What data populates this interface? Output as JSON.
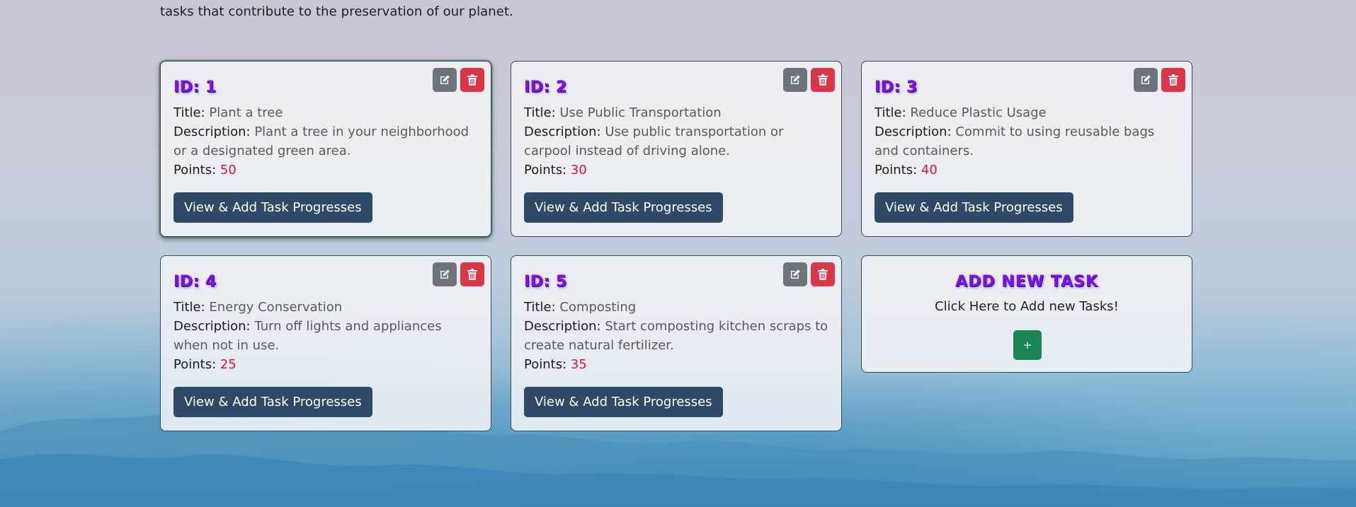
{
  "intro": {
    "text": "tasks that contribute to the preservation of our planet."
  },
  "labels": {
    "title": "Title:",
    "description": "Description:",
    "points": "Points:",
    "progress_button": "View & Add Task Progresses"
  },
  "icons": {
    "edit": "edit-icon",
    "delete": "trash-icon",
    "add": "plus-icon"
  },
  "colors": {
    "edit_button": "#6c757d",
    "delete_button": "#dc3545",
    "progress_button": "#2f4a66",
    "add_button": "#198754",
    "id_text": "#7b12f0",
    "points_value": "#dc143c"
  },
  "tasks": [
    {
      "id_label": "ID: 1",
      "title": "Plant a tree",
      "description": "Plant a tree in your neighborhood or a designated green area.",
      "points": "50"
    },
    {
      "id_label": "ID: 2",
      "title": "Use Public Transportation",
      "description": "Use public transportation or carpool instead of driving alone.",
      "points": "30"
    },
    {
      "id_label": "ID: 3",
      "title": "Reduce Plastic Usage",
      "description": "Commit to using reusable bags and containers.",
      "points": "40"
    },
    {
      "id_label": "ID: 4",
      "title": "Energy Conservation",
      "description": "Turn off lights and appliances when not in use.",
      "points": "25"
    },
    {
      "id_label": "ID: 5",
      "title": "Composting",
      "description": "Start composting kitchen scraps to create natural fertilizer.",
      "points": "35"
    }
  ],
  "add_task": {
    "title": "ADD NEW TASK",
    "subtitle": "Click Here to Add new Tasks!",
    "button_label": "+"
  }
}
